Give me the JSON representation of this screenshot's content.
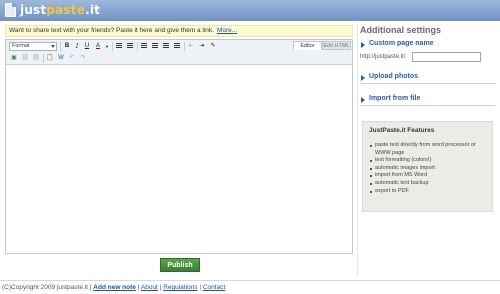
{
  "header": {
    "logo_part1": "just",
    "logo_part2": "paste",
    "logo_part3": ".it"
  },
  "notice": {
    "text": "Want to share text with your friends? Paste it here and give them a link.",
    "more_link": "More..."
  },
  "editor": {
    "format_label": "Format",
    "tabs": [
      "Editor",
      "Edit HTML"
    ],
    "toolbar_buttons": [
      "bold",
      "italic",
      "underline",
      "text-color",
      "ordered-list",
      "unordered-list",
      "align-left",
      "align-center",
      "align-right",
      "align-justify",
      "outdent",
      "indent",
      "remove-format",
      "image",
      "link",
      "unlink",
      "paste",
      "paste-word",
      "undo",
      "redo"
    ]
  },
  "publish_label": "Publish",
  "sidebar": {
    "title": "Additional settings",
    "custom_page_name": "Custom page name",
    "url_prefix": "http://justpaste.it/",
    "upload_photos": "Upload photos",
    "import_from_file": "Import from file",
    "features_title": "JustPaste.it Features",
    "features": [
      "paste text directly from word processor or WWW page",
      "text formatting (colors!)",
      "automatic images import",
      "import from MS Word",
      "automatic text backup",
      "export to PDF"
    ]
  },
  "footer": {
    "copyright": "(C)Copyright 2009 justpaste.it |",
    "add_new_note": "Add new note",
    "about": "About",
    "regulations": "Regulations",
    "contact": "Contact",
    "sep": "|"
  },
  "colors": {
    "header_top": "#9fb9dc",
    "header_bottom": "#6f92c4",
    "logo_accent": "#f5c63a",
    "link": "#2b5aa8",
    "publish": "#4a9340",
    "notice_bg": "#fdfbd2"
  }
}
